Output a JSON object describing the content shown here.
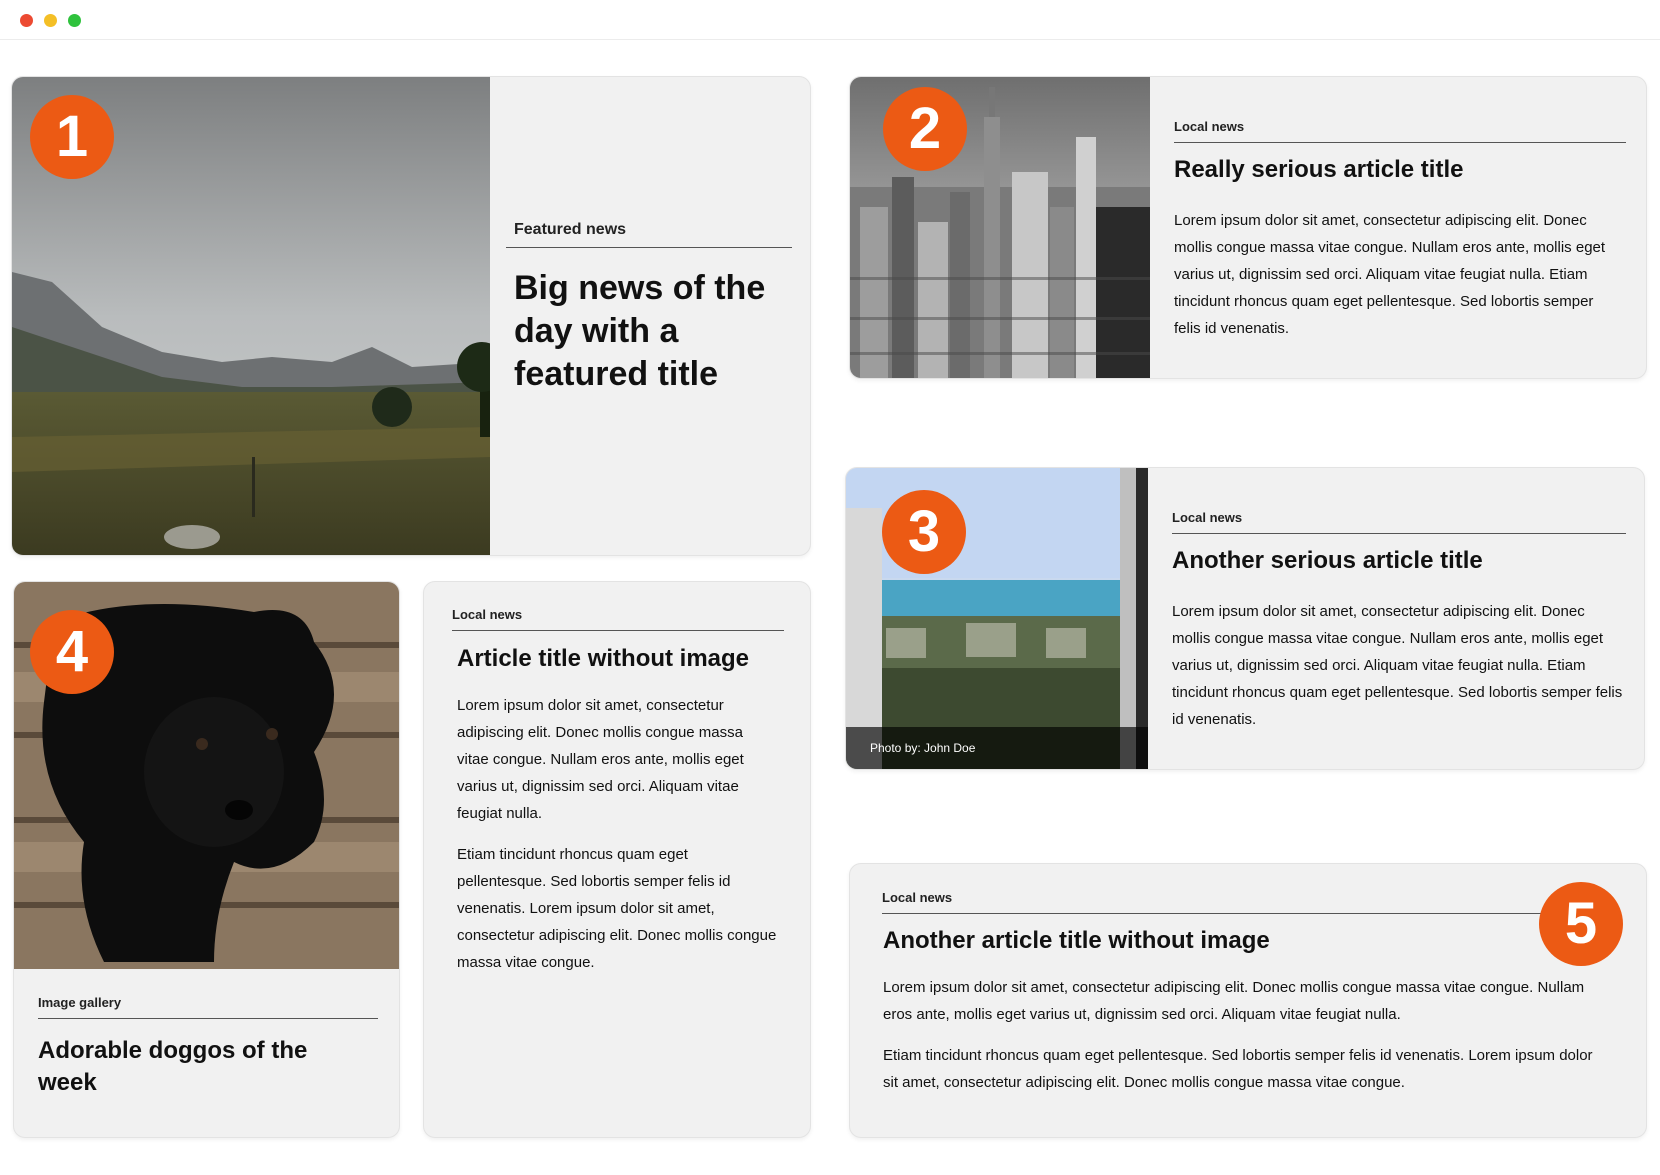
{
  "colors": {
    "accent": "#ec5a14",
    "card_bg": "#f1f1f1"
  },
  "window": {
    "controls": [
      "close",
      "minimize",
      "maximize"
    ]
  },
  "cards": {
    "featured": {
      "badge": "1",
      "kicker": "Featured news",
      "title": "Big news of the day with a featured title",
      "image_icon": "landscape-image"
    },
    "article2": {
      "badge": "2",
      "kicker": "Local news",
      "title": "Really serious article title",
      "body": "Lorem ipsum dolor sit amet, consectetur adipiscing elit. Donec mollis congue massa vitae congue. Nullam eros ante, mollis eget varius ut, dignissim sed orci. Aliquam vitae feugiat nulla. Etiam tincidunt rhoncus quam eget pellentesque. Sed lobortis semper felis id venenatis.",
      "image_icon": "city-skyline-image"
    },
    "article3": {
      "badge": "3",
      "kicker": "Local news",
      "title": "Another serious article title",
      "body": "Lorem ipsum dolor sit amet, consectetur adipiscing elit. Donec mollis congue massa vitae congue. Nullam eros ante, mollis eget varius ut, dignissim sed orci. Aliquam vitae feugiat nulla. Etiam tincidunt rhoncus quam eget pellentesque. Sed lobortis semper felis id venenatis.",
      "caption": "Photo by: John Doe",
      "image_icon": "ocean-view-image"
    },
    "gallery": {
      "badge": "4",
      "kicker": "Image gallery",
      "title": "Adorable doggos of the week",
      "image_icon": "dog-image"
    },
    "noimage": {
      "kicker": "Local news",
      "title": "Article title without image",
      "p1": "Lorem ipsum dolor sit amet, consectetur adipiscing elit. Donec mollis congue massa vitae congue. Nullam eros ante, mollis eget varius ut, dignissim sed orci. Aliquam vitae feugiat nulla.",
      "p2": "Etiam tincidunt rhoncus quam eget pellentesque. Sed lobortis semper felis id venenatis. Lorem ipsum dolor sit amet, consectetur adipiscing elit. Donec mollis congue massa vitae congue."
    },
    "noimage2": {
      "badge": "5",
      "kicker": "Local news",
      "title": "Another article title without image",
      "p1": "Lorem ipsum dolor sit amet, consectetur adipiscing elit. Donec mollis congue massa vitae congue. Nullam eros ante, mollis eget varius ut, dignissim sed orci. Aliquam vitae feugiat nulla.",
      "p2": "Etiam tincidunt rhoncus quam eget pellentesque. Sed lobortis semper felis id venenatis. Lorem ipsum dolor sit amet, consectetur adipiscing elit. Donec mollis congue massa vitae congue."
    }
  }
}
